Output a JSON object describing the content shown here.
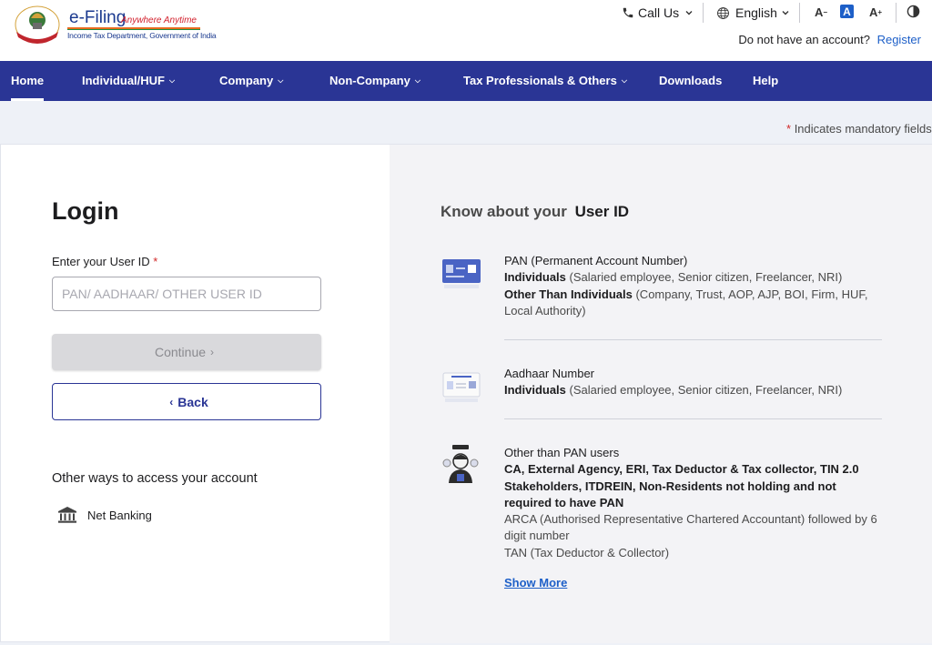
{
  "header": {
    "brand_main": "e-Filing",
    "brand_tagline": "Anywhere Anytime",
    "brand_sub": "Income Tax Department, Government of India",
    "call_us": "Call Us",
    "language": "English",
    "font_decrease": "A",
    "font_normal": "A",
    "font_increase": "A",
    "account_prompt": "Do not have an account?",
    "register": "Register"
  },
  "nav": {
    "items": [
      {
        "label": "Home",
        "active": true
      },
      {
        "label": "Individual/HUF",
        "dropdown": true
      },
      {
        "label": "Company",
        "dropdown": true
      },
      {
        "label": "Non-Company",
        "dropdown": true
      },
      {
        "label": "Tax Professionals & Others",
        "dropdown": true
      },
      {
        "label": "Downloads"
      },
      {
        "label": "Help"
      }
    ]
  },
  "mandatory_note": "Indicates mandatory fields",
  "mandatory_star": "*",
  "login": {
    "title": "Login",
    "user_id_label": "Enter your User ID",
    "required_mark": "*",
    "user_id_value": "",
    "user_id_placeholder": "PAN/ AADHAAR/ OTHER USER ID",
    "continue_label": "Continue",
    "back_label": "Back",
    "other_ways": "Other ways to access your account",
    "net_banking": "Net Banking"
  },
  "know": {
    "prefix": "Know about your",
    "emphasis": "User ID",
    "items": [
      {
        "title": "PAN (Permanent Account Number)",
        "line1_bold": "Individuals",
        "line1_rest": " (Salaried employee, Senior citizen, Freelancer, NRI)",
        "line2_bold": "Other Than Individuals",
        "line2_rest": " (Company, Trust, AOP, AJP, BOI, Firm, HUF, Local Authority)"
      },
      {
        "title": "Aadhaar Number",
        "line1_bold": "Individuals",
        "line1_rest": " (Salaried employee, Senior citizen, Freelancer, NRI)"
      },
      {
        "title": "Other than PAN users",
        "bold_text": "CA, External Agency, ERI, Tax Deductor & Tax collector, TIN 2.0 Stakeholders, ITDREIN, Non-Residents not holding and not required to have PAN",
        "arca": "ARCA (Authorised Representative Chartered Accountant) followed by 6 digit number",
        "tan": "TAN (Tax Deductor & Collector)"
      }
    ],
    "show_more": "Show More"
  },
  "colors": {
    "nav_bg": "#2a3595",
    "link": "#1d5fc8",
    "required": "#d12929"
  }
}
